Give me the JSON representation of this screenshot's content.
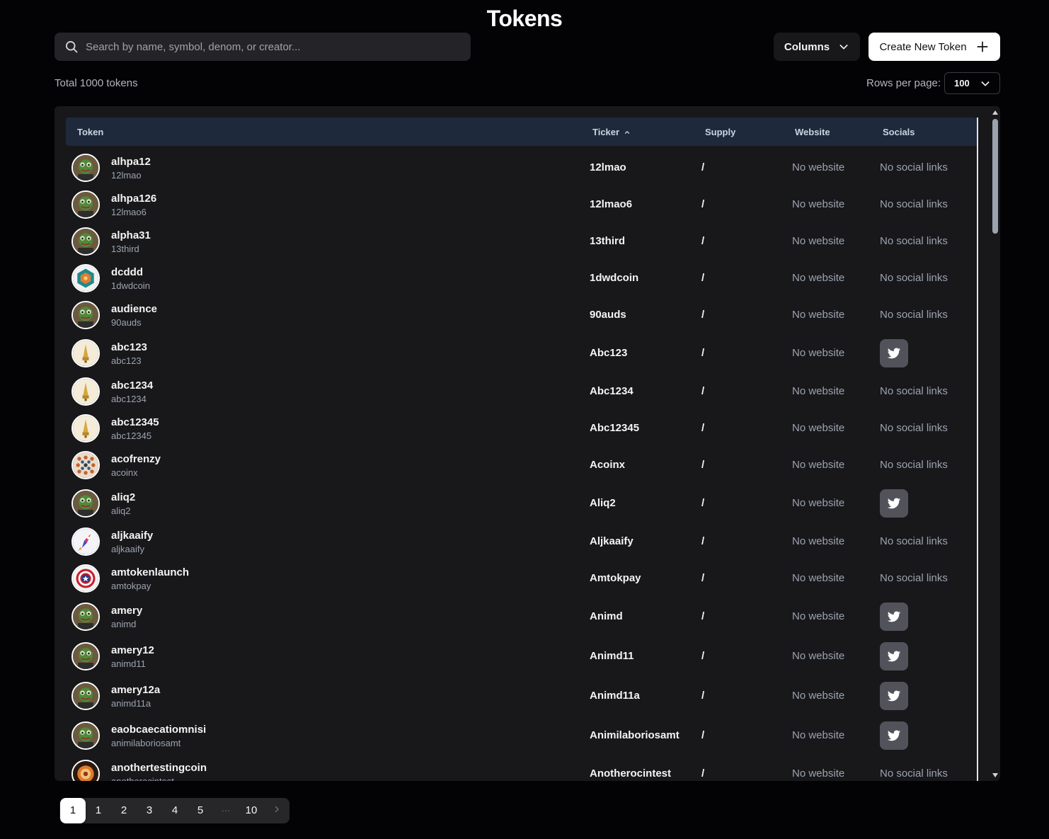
{
  "page": {
    "title": "Tokens",
    "search_placeholder": "Search by name, symbol, denom, or creator...",
    "columns_label": "Columns",
    "create_label": "Create New Token",
    "total_label": "Total 1000 tokens",
    "rows_per_page_label": "Rows per page:",
    "rows_per_page_value": "100"
  },
  "table": {
    "headers": {
      "token": "Token",
      "ticker": "Ticker",
      "supply": "Supply",
      "website": "Website",
      "socials": "Socials"
    },
    "rows": [
      {
        "name": "alhpa12",
        "symbol": "12lmao",
        "ticker": "12lmao",
        "supply": "/",
        "website": "No website",
        "socials": "No social links",
        "has_twitter": false,
        "avatar": "frog"
      },
      {
        "name": "alhpa126",
        "symbol": "12lmao6",
        "ticker": "12lmao6",
        "supply": "/",
        "website": "No website",
        "socials": "No social links",
        "has_twitter": false,
        "avatar": "frog"
      },
      {
        "name": "alpha31",
        "symbol": "13third",
        "ticker": "13third",
        "supply": "/",
        "website": "No website",
        "socials": "No social links",
        "has_twitter": false,
        "avatar": "frog"
      },
      {
        "name": "dcddd",
        "symbol": "1dwdcoin",
        "ticker": "1dwdcoin",
        "supply": "/",
        "website": "No website",
        "socials": "No social links",
        "has_twitter": false,
        "avatar": "hex"
      },
      {
        "name": "audience",
        "symbol": "90auds",
        "ticker": "90auds",
        "supply": "/",
        "website": "No website",
        "socials": "No social links",
        "has_twitter": false,
        "avatar": "frog"
      },
      {
        "name": "abc123",
        "symbol": "abc123",
        "ticker": "Abc123",
        "supply": "/",
        "website": "No website",
        "socials": "",
        "has_twitter": true,
        "avatar": "cream"
      },
      {
        "name": "abc1234",
        "symbol": "abc1234",
        "ticker": "Abc1234",
        "supply": "/",
        "website": "No website",
        "socials": "No social links",
        "has_twitter": false,
        "avatar": "cream"
      },
      {
        "name": "abc12345",
        "symbol": "abc12345",
        "ticker": "Abc12345",
        "supply": "/",
        "website": "No website",
        "socials": "No social links",
        "has_twitter": false,
        "avatar": "cream"
      },
      {
        "name": "acofrenzy",
        "symbol": "acoinx",
        "ticker": "Acoinx",
        "supply": "/",
        "website": "No website",
        "socials": "No social links",
        "has_twitter": false,
        "avatar": "dots"
      },
      {
        "name": "aliq2",
        "symbol": "aliq2",
        "ticker": "Aliq2",
        "supply": "/",
        "website": "No website",
        "socials": "",
        "has_twitter": true,
        "avatar": "frog"
      },
      {
        "name": "aljkaaify",
        "symbol": "aljkaaify",
        "ticker": "Aljkaaify",
        "supply": "/",
        "website": "No website",
        "socials": "No social links",
        "has_twitter": false,
        "avatar": "rocket"
      },
      {
        "name": "amtokenlaunch",
        "symbol": "amtokpay",
        "ticker": "Amtokpay",
        "supply": "/",
        "website": "No website",
        "socials": "No social links",
        "has_twitter": false,
        "avatar": "shield"
      },
      {
        "name": "amery",
        "symbol": "animd",
        "ticker": "Animd",
        "supply": "/",
        "website": "No website",
        "socials": "",
        "has_twitter": true,
        "avatar": "frog"
      },
      {
        "name": "amery12",
        "symbol": "animd11",
        "ticker": "Animd11",
        "supply": "/",
        "website": "No website",
        "socials": "",
        "has_twitter": true,
        "avatar": "frog"
      },
      {
        "name": "amery12a",
        "symbol": "animd11a",
        "ticker": "Animd11a",
        "supply": "/",
        "website": "No website",
        "socials": "",
        "has_twitter": true,
        "avatar": "frog"
      },
      {
        "name": "eaobcaecatiomnisi",
        "symbol": "animilaboriosamt",
        "ticker": "Animilaboriosamt",
        "supply": "/",
        "website": "No website",
        "socials": "",
        "has_twitter": true,
        "avatar": "frog"
      },
      {
        "name": "anothertestingcoin",
        "symbol": "anotherocintest",
        "ticker": "Anotherocintest",
        "supply": "/",
        "website": "No website",
        "socials": "No social links",
        "has_twitter": false,
        "avatar": "orange"
      }
    ]
  },
  "pagination": {
    "pages": [
      "1",
      "1",
      "2",
      "3",
      "4",
      "5",
      "···",
      "10"
    ],
    "active_index": 0
  },
  "icons": {
    "search": "search-icon",
    "columns_chevron": "chevron-down-icon",
    "create": "plus-icon",
    "rpp_chevron": "chevron-down-icon",
    "sort": "chevron-up-icon",
    "twitter": "twitter-icon",
    "next": "chevron-right-icon"
  },
  "colors": {
    "background": "#030306",
    "panel": "#18181b",
    "header_row": "#1e293b",
    "twitter_button": "#52525b"
  }
}
